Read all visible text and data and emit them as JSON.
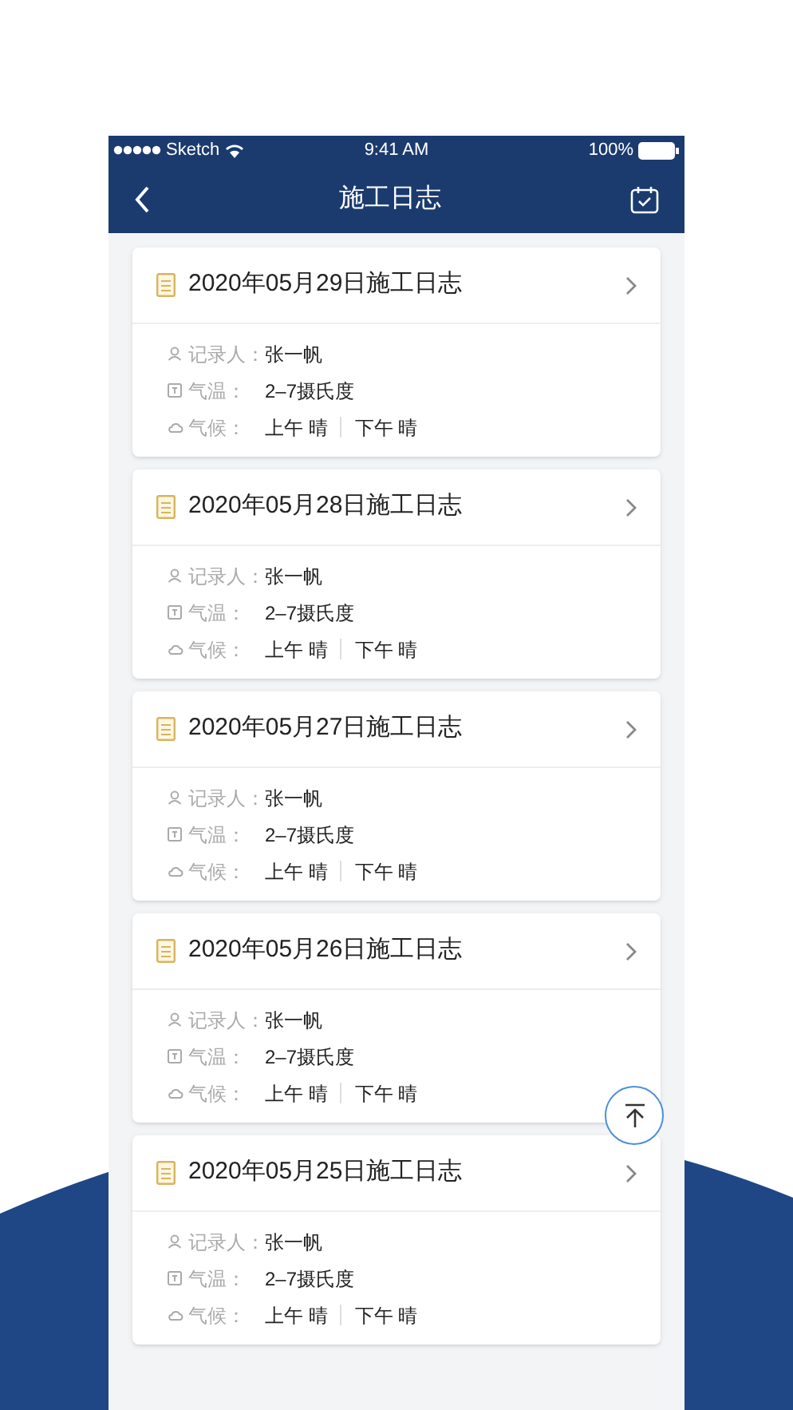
{
  "status_bar": {
    "carrier": "Sketch",
    "time": "9:41 AM",
    "battery": "100%"
  },
  "nav": {
    "title": "施工日志"
  },
  "logs": [
    {
      "title": "2020年05月29日施工日志",
      "recorder_label": "记录人：",
      "recorder": "张一帆",
      "temperature_label": "气温：",
      "temperature": "2–7摄氏度",
      "climate_label": "气候：",
      "morning": "上午 晴",
      "afternoon": "下午 晴"
    },
    {
      "title": "2020年05月28日施工日志",
      "recorder_label": "记录人：",
      "recorder": "张一帆",
      "temperature_label": "气温：",
      "temperature": "2–7摄氏度",
      "climate_label": "气候：",
      "morning": "上午 晴",
      "afternoon": "下午 晴"
    },
    {
      "title": "2020年05月27日施工日志",
      "recorder_label": "记录人：",
      "recorder": "张一帆",
      "temperature_label": "气温：",
      "temperature": "2–7摄氏度",
      "climate_label": "气候：",
      "morning": "上午 晴",
      "afternoon": "下午 晴"
    },
    {
      "title": "2020年05月26日施工日志",
      "recorder_label": "记录人：",
      "recorder": "张一帆",
      "temperature_label": "气温：",
      "temperature": "2–7摄氏度",
      "climate_label": "气候：",
      "morning": "上午 晴",
      "afternoon": "下午 晴"
    },
    {
      "title": "2020年05月25日施工日志",
      "recorder_label": "记录人：",
      "recorder": "张一帆",
      "temperature_label": "气温：",
      "temperature": "2–7摄氏度",
      "climate_label": "气候：",
      "morning": "上午 晴",
      "afternoon": "下午 晴"
    }
  ]
}
